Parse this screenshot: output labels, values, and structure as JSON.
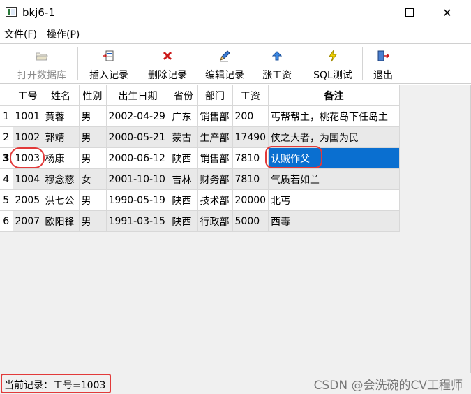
{
  "window": {
    "title": "bkj6-1",
    "minimize_label": "—",
    "close_label": "✕"
  },
  "menu": [
    {
      "label": "文件(F)"
    },
    {
      "label": "操作(P)"
    }
  ],
  "toolbar": {
    "open_db": {
      "label": "打开数据库",
      "icon": "folder-icon",
      "enabled": false
    },
    "insert": {
      "label": "插入记录",
      "icon": "insert-record-icon"
    },
    "delete": {
      "label": "删除记录",
      "icon": "delete-x-icon",
      "color": "#cc1a1a"
    },
    "edit": {
      "label": "编辑记录",
      "icon": "pencil-icon"
    },
    "raise": {
      "label": "涨工资",
      "icon": "up-arrow-icon",
      "color": "#1a5fc4"
    },
    "sql": {
      "label": "SQL测试",
      "icon": "lightning-icon",
      "color": "#e0c000"
    },
    "exit": {
      "label": "退出",
      "icon": "exit-door-icon"
    }
  },
  "table": {
    "headers": [
      "工号",
      "姓名",
      "性别",
      "出生日期",
      "省份",
      "部门",
      "工资",
      "备注"
    ],
    "rows": [
      {
        "num": "1",
        "cells": [
          "1001",
          "黄蓉",
          "男",
          "2002-04-29",
          "广东",
          "销售部",
          "200",
          "丐帮帮主，桃花岛下任岛主"
        ]
      },
      {
        "num": "2",
        "cells": [
          "1002",
          "郭靖",
          "男",
          "2000-05-21",
          "蒙古",
          "生产部",
          "17490",
          "侠之大者，为国为民"
        ]
      },
      {
        "num": "3",
        "cells": [
          "1003",
          "杨康",
          "男",
          "2000-06-12",
          "陕西",
          "销售部",
          "7810",
          "认贼作父"
        ]
      },
      {
        "num": "4",
        "cells": [
          "1004",
          "穆念慈",
          "女",
          "2001-10-10",
          "吉林",
          "财务部",
          "7810",
          "气质若如兰"
        ]
      },
      {
        "num": "5",
        "cells": [
          "2005",
          "洪七公",
          "男",
          "1990-05-19",
          "陕西",
          "技术部",
          "20000",
          "北丐"
        ]
      },
      {
        "num": "6",
        "cells": [
          "2007",
          "欧阳锋",
          "男",
          "1991-03-15",
          "陕西",
          "行政部",
          "5000",
          "西毒"
        ]
      }
    ],
    "current_row": 3,
    "selected_color": "#0a6fd0"
  },
  "status": {
    "text": "当前记录：工号=1003"
  },
  "watermark": "CSDN @会洗碗的CV工程师",
  "annotation_color": "#e23a3a"
}
